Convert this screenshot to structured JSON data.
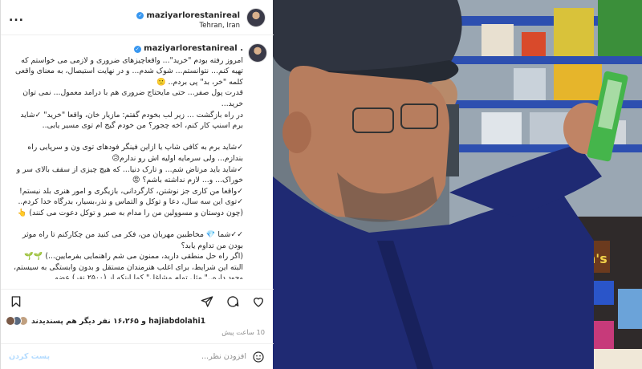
{
  "header": {
    "username": "maziyarlorestanireal",
    "location": "Tehran, Iran",
    "more_label": "..."
  },
  "caption": {
    "username": "maziyarlorestanireal",
    "lead": ".",
    "text": "امروز رفته بودم \"خرید\"... واقعاچیزهای ضروری و لازمی می خواستم که تهیه کنم... نتوانستم... شوک شدم... و در نهایت استیصال، به معنای واقعی کلمه \"خر، بد\" پی بردم.. 🙁\nقدرت پول صفر... حتی مایحتاج ضروری هم با درامد معمول... نمی توان خرید...\nدر راه بازگشت ... زیر لب بخودم گفتم: مازیار خان، واقعا \"خرید\" ✓شاید برم اسنپ کار کنم، اخه چجور؟ من خودم گیج ام توی مسیر یابی..\n\n✓شاید برم به کافی شاپ یا ازاین فینگر فودهای توی ون و سرپایی راه بندازم... ولی سرمایه اولیه اش رو ندارم😥\n✓شاید باید مرتاض شم... و تارک دنیا... که هیچ چیزی از سقف بالای سر و خوراک... و... لازم نداشته باشم؟ 😡\n✓واقعا من کاری جز نوشتن، کارگردانی، بازیگری و امور هنری بلد نیستم!\n✓توی این سه سال، دعا و توکل و التماس و نذر،بسیار، بدرگاه خدا کردم..(چون دوستان و مسوولین من را مدام به صبر و توکل دعوت می کنند) 👆\n\n✓✓شما 💎 مخاطبین مهربان من، فکر می کنید من چکارکنم تا راه موثر بودن من تداوم یابد؟\n(اگر راه حل منطقی دارید، ممنون می شم راهنمایی بفرمایین...) 🌱🌱\nالبته این شرایط، برای اغلب هنرمندان مستقل و بدون وابستگی به سیستم، وجود داره..\" مثل تمام مشاغل\" کما اینکه از (۲۵۰۰ نفر) عضو"
  },
  "likes": {
    "text": "hajiabdolahi1 و ۱۶،۲۶۵ نفر دیگر هم پسندیدند"
  },
  "time": "10 ساعت پیش",
  "comment": {
    "placeholder": "افزودن نظر...",
    "post_label": "پست کردن"
  },
  "icons": {
    "like": "heart-icon",
    "comment": "comment-icon",
    "share": "send-icon",
    "save": "bookmark-icon",
    "emoji": "smiley-icon"
  },
  "colors": {
    "verified": "#3897f0",
    "post_button": "#b3dbff"
  }
}
